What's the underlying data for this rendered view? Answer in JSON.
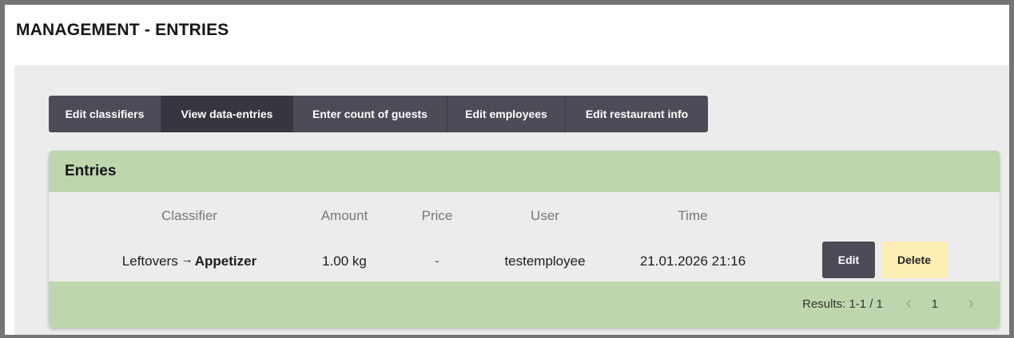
{
  "header": {
    "title": "MANAGEMENT - ENTRIES"
  },
  "tabs": [
    {
      "label": "Edit classifiers",
      "active": false
    },
    {
      "label": "View data-entries",
      "active": true
    },
    {
      "label": "Enter count of guests",
      "active": false
    },
    {
      "label": "Edit employees",
      "active": false
    },
    {
      "label": "Edit restaurant info",
      "active": false
    }
  ],
  "entries": {
    "title": "Entries",
    "columns": [
      "Classifier",
      "Amount",
      "Price",
      "User",
      "Time"
    ],
    "rows": [
      {
        "classifier_parent": "Leftovers",
        "arrow": "→",
        "classifier_child": "Appetizer",
        "amount": "1.00 kg",
        "price": "-",
        "user": "testemployee",
        "time": "21.01.2026 21:16",
        "edit_label": "Edit",
        "delete_label": "Delete"
      }
    ],
    "footer": {
      "results": "Results: 1-1 / 1",
      "prev_icon": "chevron-left-icon",
      "prev_glyph": "‹",
      "page": "1",
      "next_icon": "chevron-right-icon",
      "next_glyph": "›"
    }
  },
  "colors": {
    "tab_bg": "#4b4c57",
    "tab_active_bg": "#35363f",
    "header_green": "#bdd6ae",
    "delete_yellow": "#fdefb4"
  }
}
